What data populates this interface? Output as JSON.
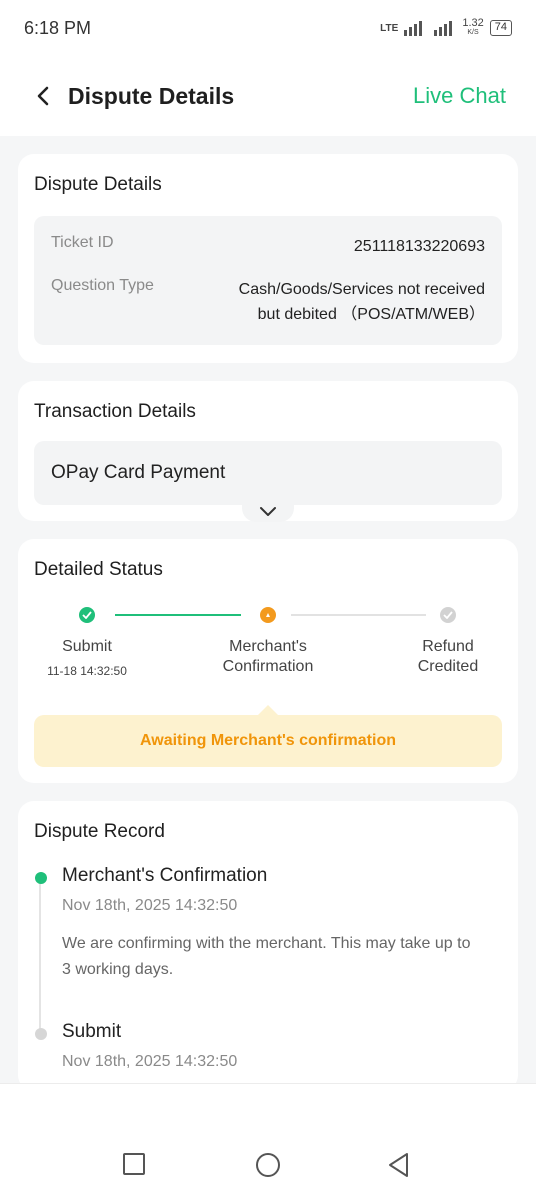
{
  "status_bar": {
    "time": "6:18 PM",
    "network": "LTE",
    "speed_value": "1.32",
    "speed_unit": "K/S",
    "battery": "74"
  },
  "header": {
    "title": "Dispute Details",
    "live_chat": "Live Chat"
  },
  "dispute_details": {
    "title": "Dispute Details",
    "ticket_label": "Ticket ID",
    "ticket_value": "251118133220693",
    "question_label": "Question Type",
    "question_value_line1": "Cash/Goods/Services not received",
    "question_value_line2": "but debited （POS/ATM/WEB）"
  },
  "transaction_details": {
    "title": "Transaction Details",
    "item": "OPay Card Payment"
  },
  "detailed_status": {
    "title": "Detailed Status",
    "steps": [
      {
        "label": "Submit",
        "time": "11-18 14:32:50",
        "state": "done"
      },
      {
        "label_line1": "Merchant's",
        "label_line2": "Confirmation",
        "state": "current"
      },
      {
        "label_line1": "Refund",
        "label_line2": "Credited",
        "state": "pending"
      }
    ],
    "notice": "Awaiting Merchant's confirmation"
  },
  "dispute_record": {
    "title": "Dispute Record",
    "items": [
      {
        "title": "Merchant's Confirmation",
        "time": "Nov 18th, 2025 14:32:50",
        "desc_line1": "We are confirming with the merchant. This may take up to",
        "desc_line2": "3 working days."
      },
      {
        "title": "Submit",
        "time": "Nov 18th, 2025 14:32:50"
      }
    ]
  },
  "colors": {
    "accent": "#1fbf7a",
    "current": "#f39a1e",
    "pending": "#cfcfcf",
    "notice_bg": "#fdf2cf",
    "notice_text": "#f0950a"
  },
  "icons": [
    "back-chevron-icon",
    "check-icon",
    "chevron-down-icon",
    "square-icon",
    "circle-icon",
    "triangle-back-icon"
  ]
}
